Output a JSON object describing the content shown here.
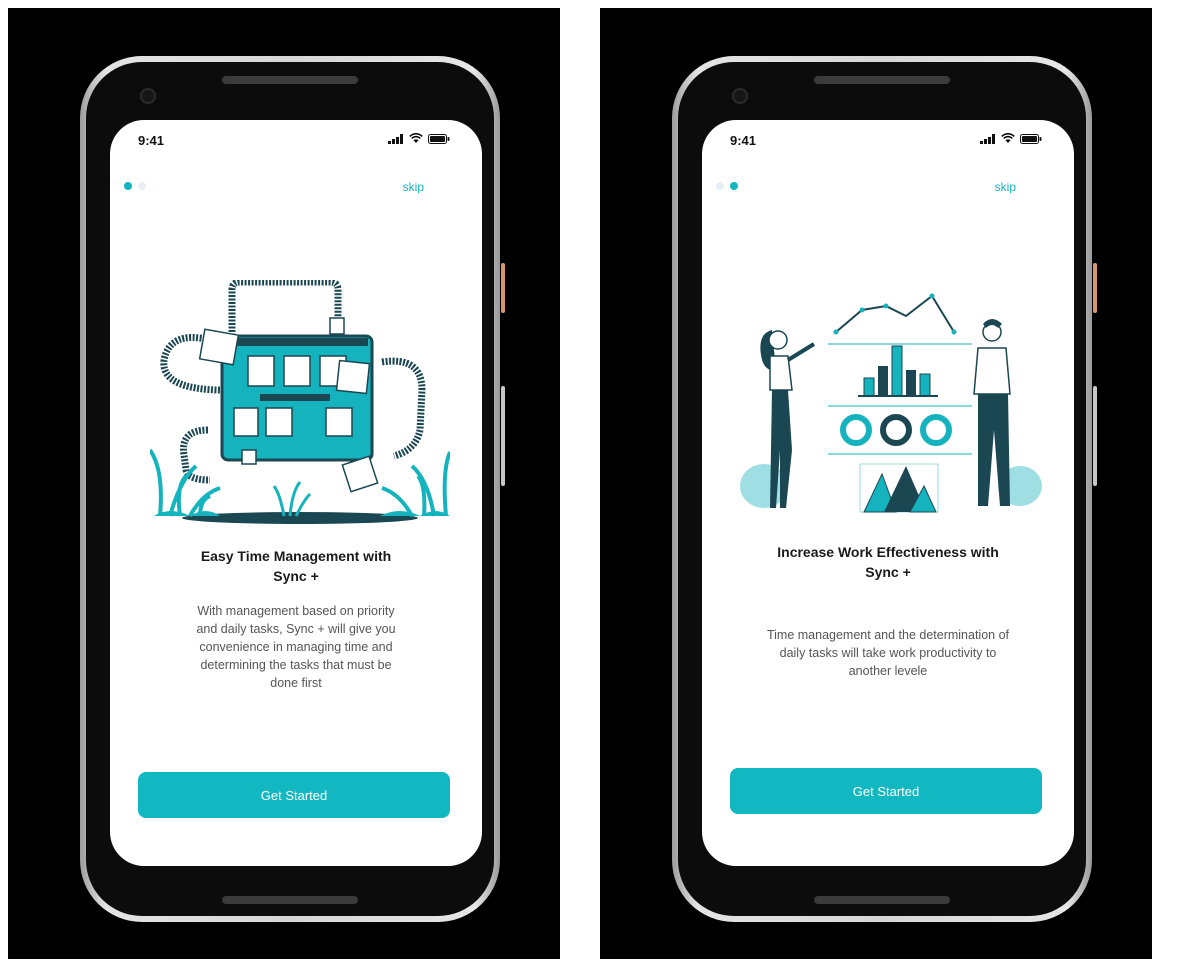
{
  "screens": [
    {
      "status_time": "9:41",
      "skip_label": "skip",
      "active_dot": 0,
      "title_line1": "Easy Time Management with",
      "title_line2": "Sync +",
      "description": "With management based on priority\nand daily tasks, Sync + will give you\nconvenience in managing time and\ndetermining the tasks that must be\ndone first",
      "button_label": "Get Started",
      "illustration_icon": "conveyor-board-illustration"
    },
    {
      "status_time": "9:41",
      "skip_label": "skip",
      "active_dot": 1,
      "title_line1": "Increase Work Effectiveness with",
      "title_line2": "Sync +",
      "description": "Time management and the determination of\ndaily tasks will take work productivity to\nanother levele",
      "button_label": "Get Started",
      "illustration_icon": "analytics-team-illustration"
    }
  ],
  "colors": {
    "accent": "#12b8c1",
    "dark_teal": "#1b4752",
    "background": "#000000"
  }
}
